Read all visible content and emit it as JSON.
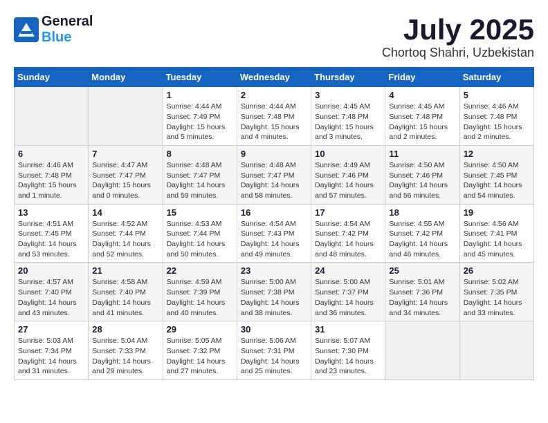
{
  "header": {
    "logo_text_general": "General",
    "logo_text_blue": "Blue",
    "month": "July 2025",
    "location": "Chortoq Shahri, Uzbekistan"
  },
  "weekdays": [
    "Sunday",
    "Monday",
    "Tuesday",
    "Wednesday",
    "Thursday",
    "Friday",
    "Saturday"
  ],
  "weeks": [
    [
      {
        "day": "",
        "info": ""
      },
      {
        "day": "",
        "info": ""
      },
      {
        "day": "1",
        "info": "Sunrise: 4:44 AM\nSunset: 7:49 PM\nDaylight: 15 hours and 5 minutes."
      },
      {
        "day": "2",
        "info": "Sunrise: 4:44 AM\nSunset: 7:48 PM\nDaylight: 15 hours and 4 minutes."
      },
      {
        "day": "3",
        "info": "Sunrise: 4:45 AM\nSunset: 7:48 PM\nDaylight: 15 hours and 3 minutes."
      },
      {
        "day": "4",
        "info": "Sunrise: 4:45 AM\nSunset: 7:48 PM\nDaylight: 15 hours and 2 minutes."
      },
      {
        "day": "5",
        "info": "Sunrise: 4:46 AM\nSunset: 7:48 PM\nDaylight: 15 hours and 2 minutes."
      }
    ],
    [
      {
        "day": "6",
        "info": "Sunrise: 4:46 AM\nSunset: 7:48 PM\nDaylight: 15 hours and 1 minute."
      },
      {
        "day": "7",
        "info": "Sunrise: 4:47 AM\nSunset: 7:47 PM\nDaylight: 15 hours and 0 minutes."
      },
      {
        "day": "8",
        "info": "Sunrise: 4:48 AM\nSunset: 7:47 PM\nDaylight: 14 hours and 59 minutes."
      },
      {
        "day": "9",
        "info": "Sunrise: 4:48 AM\nSunset: 7:47 PM\nDaylight: 14 hours and 58 minutes."
      },
      {
        "day": "10",
        "info": "Sunrise: 4:49 AM\nSunset: 7:46 PM\nDaylight: 14 hours and 57 minutes."
      },
      {
        "day": "11",
        "info": "Sunrise: 4:50 AM\nSunset: 7:46 PM\nDaylight: 14 hours and 56 minutes."
      },
      {
        "day": "12",
        "info": "Sunrise: 4:50 AM\nSunset: 7:45 PM\nDaylight: 14 hours and 54 minutes."
      }
    ],
    [
      {
        "day": "13",
        "info": "Sunrise: 4:51 AM\nSunset: 7:45 PM\nDaylight: 14 hours and 53 minutes."
      },
      {
        "day": "14",
        "info": "Sunrise: 4:52 AM\nSunset: 7:44 PM\nDaylight: 14 hours and 52 minutes."
      },
      {
        "day": "15",
        "info": "Sunrise: 4:53 AM\nSunset: 7:44 PM\nDaylight: 14 hours and 50 minutes."
      },
      {
        "day": "16",
        "info": "Sunrise: 4:54 AM\nSunset: 7:43 PM\nDaylight: 14 hours and 49 minutes."
      },
      {
        "day": "17",
        "info": "Sunrise: 4:54 AM\nSunset: 7:42 PM\nDaylight: 14 hours and 48 minutes."
      },
      {
        "day": "18",
        "info": "Sunrise: 4:55 AM\nSunset: 7:42 PM\nDaylight: 14 hours and 46 minutes."
      },
      {
        "day": "19",
        "info": "Sunrise: 4:56 AM\nSunset: 7:41 PM\nDaylight: 14 hours and 45 minutes."
      }
    ],
    [
      {
        "day": "20",
        "info": "Sunrise: 4:57 AM\nSunset: 7:40 PM\nDaylight: 14 hours and 43 minutes."
      },
      {
        "day": "21",
        "info": "Sunrise: 4:58 AM\nSunset: 7:40 PM\nDaylight: 14 hours and 41 minutes."
      },
      {
        "day": "22",
        "info": "Sunrise: 4:59 AM\nSunset: 7:39 PM\nDaylight: 14 hours and 40 minutes."
      },
      {
        "day": "23",
        "info": "Sunrise: 5:00 AM\nSunset: 7:38 PM\nDaylight: 14 hours and 38 minutes."
      },
      {
        "day": "24",
        "info": "Sunrise: 5:00 AM\nSunset: 7:37 PM\nDaylight: 14 hours and 36 minutes."
      },
      {
        "day": "25",
        "info": "Sunrise: 5:01 AM\nSunset: 7:36 PM\nDaylight: 14 hours and 34 minutes."
      },
      {
        "day": "26",
        "info": "Sunrise: 5:02 AM\nSunset: 7:35 PM\nDaylight: 14 hours and 33 minutes."
      }
    ],
    [
      {
        "day": "27",
        "info": "Sunrise: 5:03 AM\nSunset: 7:34 PM\nDaylight: 14 hours and 31 minutes."
      },
      {
        "day": "28",
        "info": "Sunrise: 5:04 AM\nSunset: 7:33 PM\nDaylight: 14 hours and 29 minutes."
      },
      {
        "day": "29",
        "info": "Sunrise: 5:05 AM\nSunset: 7:32 PM\nDaylight: 14 hours and 27 minutes."
      },
      {
        "day": "30",
        "info": "Sunrise: 5:06 AM\nSunset: 7:31 PM\nDaylight: 14 hours and 25 minutes."
      },
      {
        "day": "31",
        "info": "Sunrise: 5:07 AM\nSunset: 7:30 PM\nDaylight: 14 hours and 23 minutes."
      },
      {
        "day": "",
        "info": ""
      },
      {
        "day": "",
        "info": ""
      }
    ]
  ]
}
